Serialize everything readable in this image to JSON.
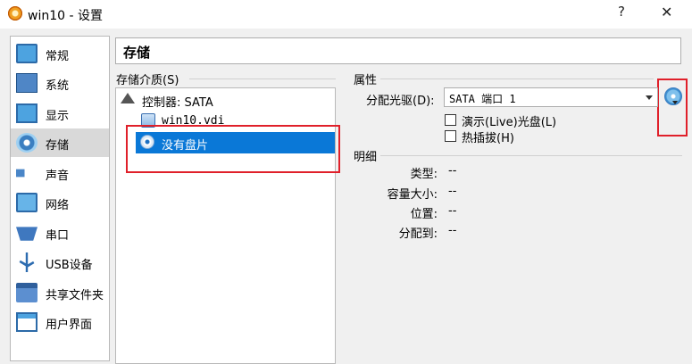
{
  "window": {
    "title": "win10 - 设置",
    "help": "?",
    "close": "✕"
  },
  "sidebar": {
    "items": [
      {
        "label": "常规",
        "icon": "monitor-icon"
      },
      {
        "label": "系统",
        "icon": "chip-icon"
      },
      {
        "label": "显示",
        "icon": "display-icon"
      },
      {
        "label": "存储",
        "icon": "storage-disk-icon",
        "selected": true
      },
      {
        "label": "声音",
        "icon": "speaker-icon"
      },
      {
        "label": "网络",
        "icon": "network-icon"
      },
      {
        "label": "串口",
        "icon": "serial-port-icon"
      },
      {
        "label": "USB设备",
        "icon": "usb-icon"
      },
      {
        "label": "共享文件夹",
        "icon": "folder-icon"
      },
      {
        "label": "用户界面",
        "icon": "user-interface-icon"
      }
    ]
  },
  "header": {
    "title": "存储"
  },
  "storage": {
    "media_label": "存储介质(S)",
    "tree": [
      {
        "label": "控制器: SATA",
        "icon": "controller-icon"
      },
      {
        "label": "win10.vdi",
        "icon": "hard-disk-icon"
      },
      {
        "label": "没有盘片",
        "icon": "optical-disc-icon",
        "selected": true
      }
    ]
  },
  "attributes": {
    "label": "属性",
    "optical_drive_label": "分配光驱(D):",
    "optical_drive_value": "SATA 端口 1",
    "live_cd_label": "演示(Live)光盘(L)",
    "hotplug_label": "热插拔(H)"
  },
  "details": {
    "label": "明细",
    "rows": [
      {
        "label": "类型:",
        "value": "--"
      },
      {
        "label": "容量大小:",
        "value": "--"
      },
      {
        "label": "位置:",
        "value": "--"
      },
      {
        "label": "分配到:",
        "value": "--"
      }
    ]
  },
  "colors": {
    "selection": "#0a78d7",
    "highlight_box": "#e0202a",
    "sidebar_selected": "#d9d9d9"
  }
}
